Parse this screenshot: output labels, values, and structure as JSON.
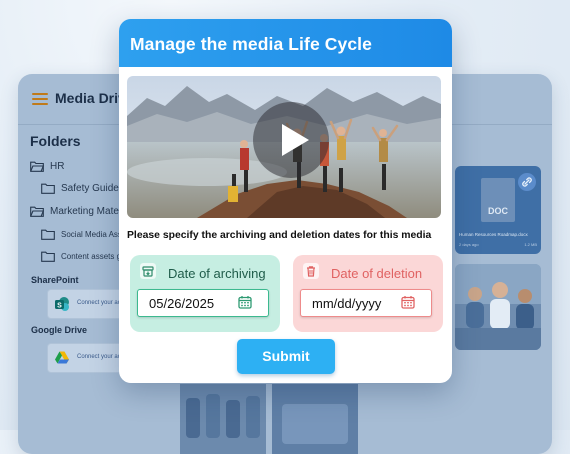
{
  "background_app": {
    "title": "Media Drive",
    "folders_title": "Folders",
    "folders": [
      {
        "label": "HR"
      },
      {
        "label": "Safety Guidelines"
      },
      {
        "label": "Marketing Materials"
      },
      {
        "label": "Social Media Assets"
      },
      {
        "label": "Content assets guide"
      }
    ],
    "sharepoint": {
      "label": "SharePoint",
      "connect_text": "Connect your account"
    },
    "google_drive": {
      "label": "Google Drive",
      "connect_text": "Connect your account"
    },
    "doc_card": {
      "badge": "DOC",
      "name": "Human Resources Roadmap.docx",
      "meta_left": "2 days ago",
      "meta_right": "1.2 MB"
    }
  },
  "modal": {
    "title": "Manage the media Life Cycle",
    "prompt": "Please specify the archiving and deletion dates for this media",
    "archive": {
      "label": "Date of archiving",
      "value": "05/26/2025"
    },
    "deletion": {
      "label": "Date of deletion",
      "placeholder": "mm/dd/yyyy"
    },
    "submit_label": "Submit"
  },
  "colors": {
    "header_blue": "#1e8ae6",
    "archive_bg": "#c6eee2",
    "archive_accent": "#3cb98f",
    "delete_bg": "#fbd7d7",
    "delete_accent": "#e06262",
    "submit": "#2db0f3"
  },
  "icons": {
    "menu": "hamburger-icon",
    "folder": "folder-icon",
    "sharepoint": "sharepoint-icon",
    "google_drive": "google-drive-icon",
    "play": "play-icon",
    "archive": "archive-box-icon",
    "delete": "trash-icon",
    "calendar": "calendar-icon",
    "link": "link-icon"
  }
}
